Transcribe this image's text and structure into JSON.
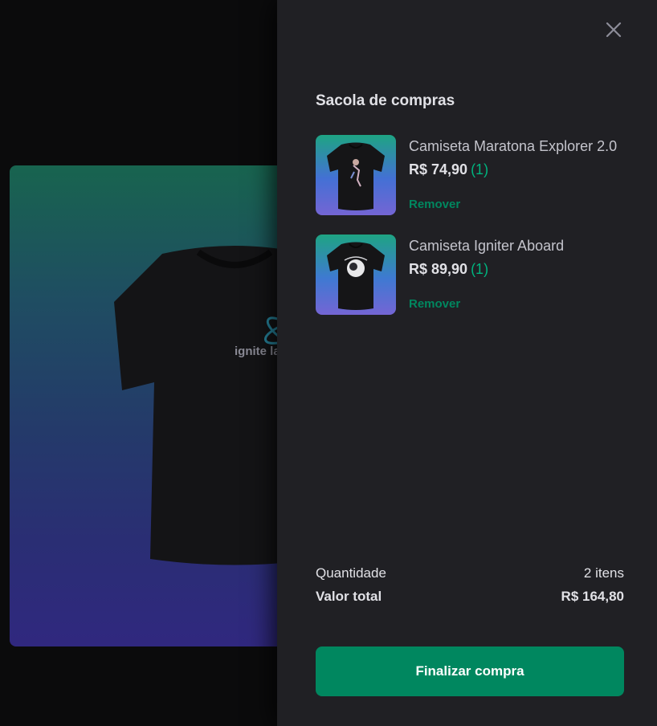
{
  "background_product": {
    "shirt_print": "ignite lab"
  },
  "drawer": {
    "title": "Sacola de compras",
    "items": [
      {
        "name": "Camiseta Maratona Explorer 2.0",
        "price": "R$ 74,90",
        "quantity": "(1)",
        "remove_label": "Remover"
      },
      {
        "name": "Camiseta Igniter Aboard",
        "price": "R$ 89,90",
        "quantity": "(1)",
        "remove_label": "Remover"
      }
    ],
    "summary": {
      "quantity_label": "Quantidade",
      "quantity_value": "2 itens",
      "total_label": "Valor total",
      "total_value": "R$ 164,80"
    },
    "checkout_label": "Finalizar compra",
    "close_icon": "close-icon"
  },
  "colors": {
    "accent": "#00875f",
    "accent_light": "#00b37e",
    "drawer_bg": "#202024",
    "text": "#e1e1e6"
  }
}
